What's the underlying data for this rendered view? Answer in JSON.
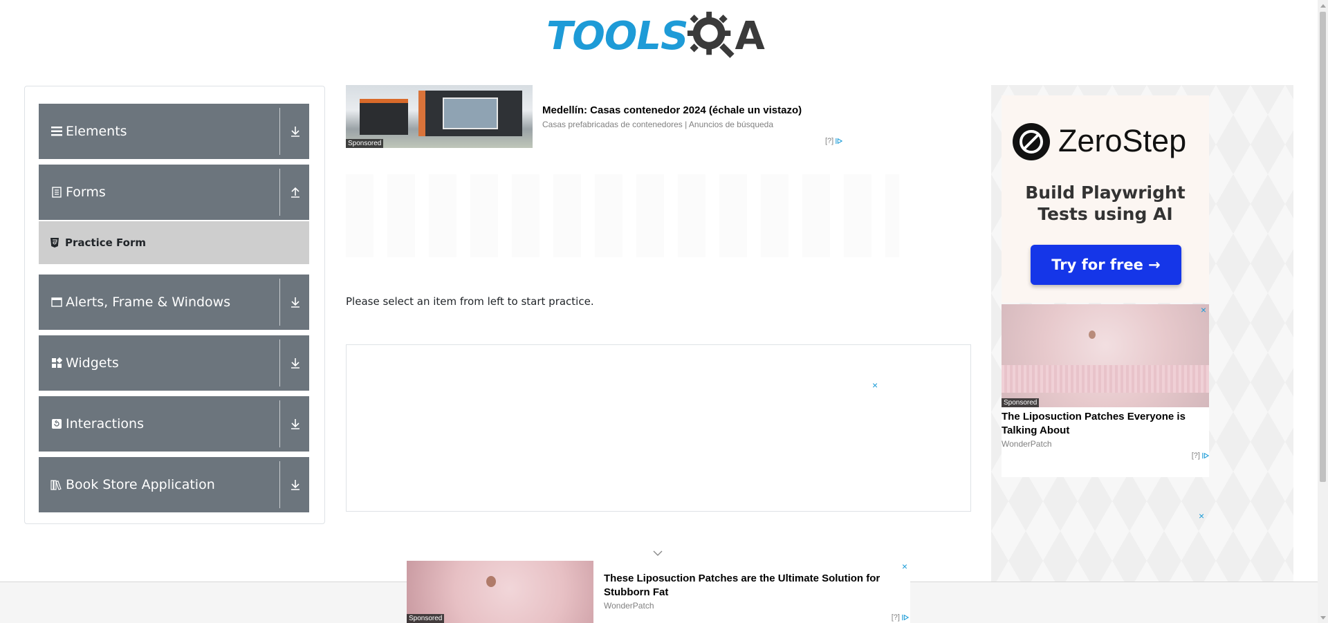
{
  "logo": {
    "text": "TOOLS",
    "a_letter": "A",
    "colors": {
      "blue": "#1e9bd7",
      "dark": "#3a3a3a"
    }
  },
  "sidebar": {
    "groups": [
      {
        "label": "Elements",
        "icon": "hamburger-icon",
        "arrow": "download-icon"
      },
      {
        "label": "Forms",
        "icon": "document-icon",
        "arrow": "upload-icon"
      },
      {
        "label": "Alerts, Frame & Windows",
        "icon": "window-icon",
        "arrow": "download-icon"
      },
      {
        "label": "Widgets",
        "icon": "widgets-icon",
        "arrow": "download-icon"
      },
      {
        "label": "Interactions",
        "icon": "interactions-icon",
        "arrow": "download-icon"
      },
      {
        "label": "Book Store Application",
        "icon": "books-icon",
        "arrow": "download-icon"
      }
    ],
    "active_sub_item": {
      "label": "Practice Form",
      "icon": "html5-icon"
    },
    "colors": {
      "group_bg": "#6c757d",
      "active_bg": "#cecece"
    }
  },
  "ads": {
    "top": {
      "headline": "Medellín: Casas contenedor 2024 (échale un vistazo)",
      "subline": "Casas prefabricadas de contenedores | Anuncios de búsqueda",
      "sponsored": "Sponsored",
      "adchoice": "[?]"
    },
    "middle_close": "×",
    "bottom": {
      "headline": "These Liposuction Patches are the Ultimate Solution for Stubborn Fat",
      "source": "WonderPatch",
      "sponsored": "Sponsored",
      "adchoice": "[?]",
      "close": "×"
    },
    "zerostep": {
      "brand": "ZeroStep",
      "tagline_1": "Build Playwright",
      "tagline_2": "Tests using AI",
      "cta": "Try for free →",
      "cta_color": "#1536e8"
    },
    "right_lipo": {
      "headline": "The Liposuction Patches Everyone is Talking About",
      "source": "WonderPatch",
      "sponsored": "Sponsored",
      "adchoice": "[?]",
      "close": "×"
    },
    "right_close_2": "×"
  },
  "main": {
    "prompt": "Please select an item from left to start practice."
  }
}
